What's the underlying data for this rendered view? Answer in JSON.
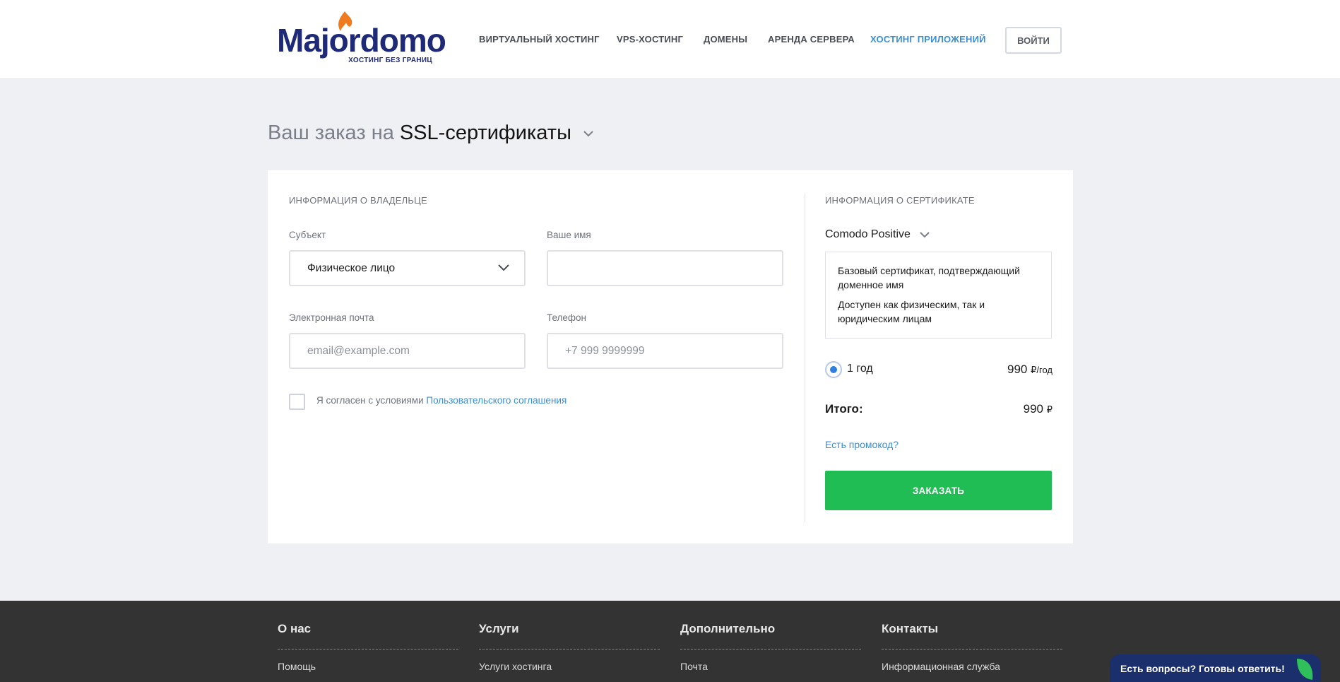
{
  "header": {
    "logo": {
      "text": "Majordomo",
      "tagline": "ХОСТИНГ БЕЗ ГРАНИЦ"
    },
    "nav": [
      {
        "label": "ВИРТУАЛЬНЫЙ ХОСТИНГ",
        "active": false
      },
      {
        "label": "VPS-ХОСТИНГ",
        "active": false
      },
      {
        "label": "ДОМЕНЫ",
        "active": false
      },
      {
        "label": "АРЕНДА СЕРВЕРА",
        "active": false
      },
      {
        "label": "ХОСТИНГ ПРИЛОЖЕНИЙ",
        "active": true
      }
    ],
    "login_label": "ВОЙТИ"
  },
  "title": {
    "prefix": "Ваш заказ на",
    "product": "SSL-сертификаты"
  },
  "owner": {
    "heading": "ИНФОРМАЦИЯ О ВЛАДЕЛЬЦЕ",
    "subject_label": "Субъект",
    "subject_value": "Физическое лицо",
    "name_label": "Ваше имя",
    "name_value": "",
    "email_label": "Электронная почта",
    "email_placeholder": "email@example.com",
    "phone_label": "Телефон",
    "phone_placeholder": "+7 999 9999999",
    "agree_text": "Я согласен с условиями ",
    "agree_link": "Пользовательского соглашения",
    "agree_checked": false
  },
  "certificate": {
    "heading": "ИНФОРМАЦИЯ О СЕРТИФИКАТЕ",
    "name": "Comodo Positive",
    "desc_1": "Базовый сертификат, подтверждающий доменное имя",
    "desc_2": "Доступен как физическим, так и юридическим лицам",
    "term": "1 год",
    "price": "990",
    "price_unit": "₽/год",
    "total_label": "Итого:",
    "total_value": "990",
    "total_unit": "₽",
    "promo_label": "Есть промокод?",
    "order_label": "ЗАКАЗАТЬ"
  },
  "footer": {
    "columns": [
      {
        "title": "О нас",
        "link": "Помощь"
      },
      {
        "title": "Услуги",
        "link": "Услуги хостинга"
      },
      {
        "title": "Дополнительно",
        "link": "Почта"
      },
      {
        "title": "Контакты",
        "link": "Информационная служба"
      }
    ]
  },
  "chat": {
    "label": "Есть вопросы? Готовы ответить!"
  },
  "colors": {
    "accent": "#3a8fd8",
    "order": "#1fbd53",
    "brand": "#1e2a78",
    "footer": "#333333"
  }
}
